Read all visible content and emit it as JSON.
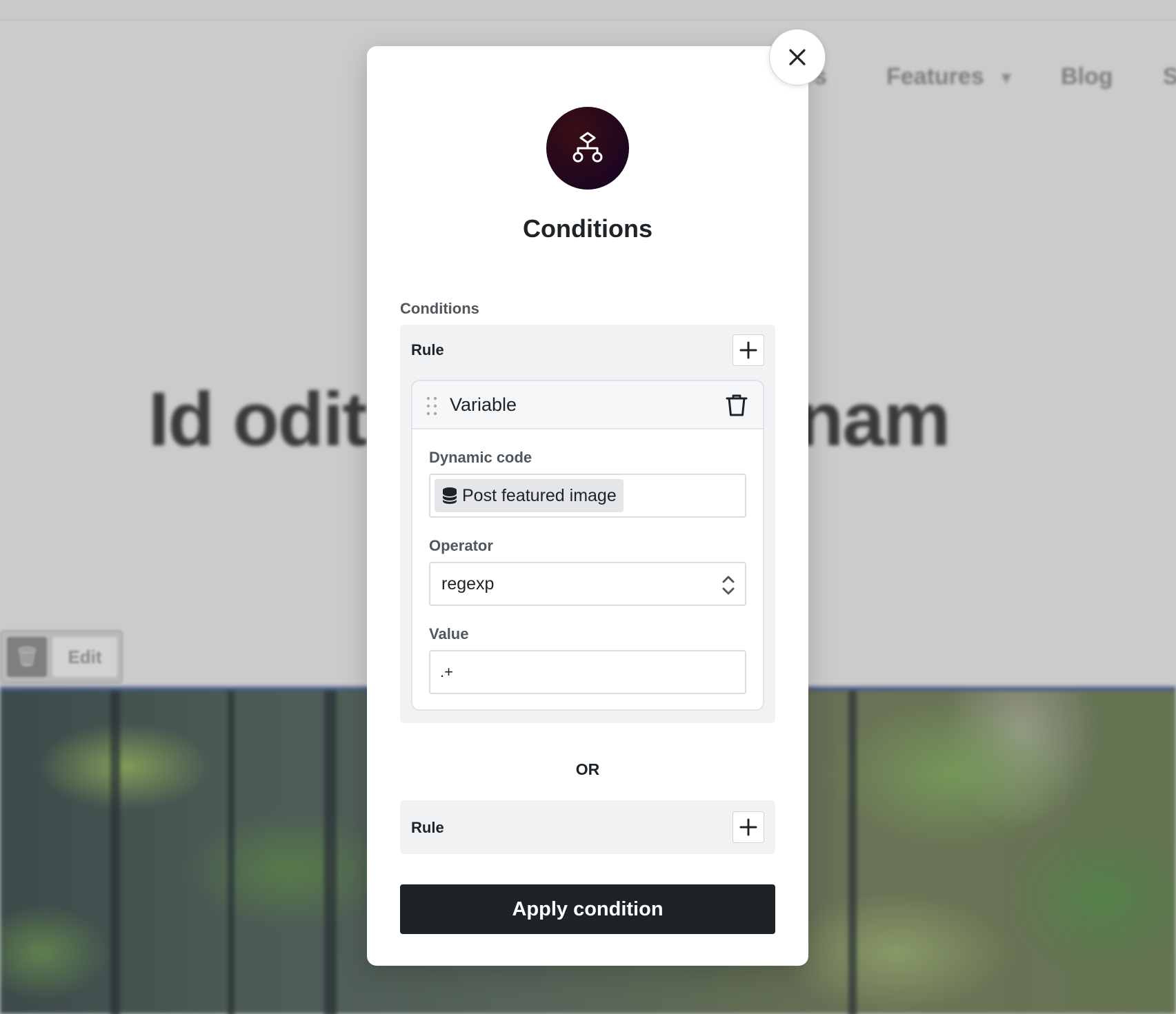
{
  "background": {
    "nav_items": [
      "s",
      "Features",
      "Blog",
      "S"
    ],
    "headline": "Id odit",
    "headline_end": "gnam",
    "toolbar_edit_label": "Edit",
    "toolbar_icon": "trash-icon"
  },
  "modal": {
    "icon": "conditional-logic-icon",
    "title": "Conditions",
    "close_icon": "close-icon",
    "section_label": "Conditions",
    "groups": [
      {
        "rule_label": "Rule",
        "add_icon": "plus-icon",
        "variable": {
          "title": "Variable",
          "drag_icon": "drag-handle-icon",
          "delete_icon": "trash-icon",
          "fields": {
            "dynamic_code_label": "Dynamic code",
            "dynamic_code_token": "Post featured image",
            "dynamic_code_token_icon": "database-icon",
            "operator_label": "Operator",
            "operator_value": "regexp",
            "value_label": "Value",
            "value_value": ".+"
          }
        }
      },
      {
        "rule_label": "Rule",
        "add_icon": "plus-icon"
      }
    ],
    "or_label": "OR",
    "apply_label": "Apply condition"
  },
  "colors": {
    "primary_button": "#1d2327",
    "overlay": "#cbcbcb",
    "icon_gradient_start": "#3a0f14",
    "icon_gradient_end": "#120428"
  }
}
